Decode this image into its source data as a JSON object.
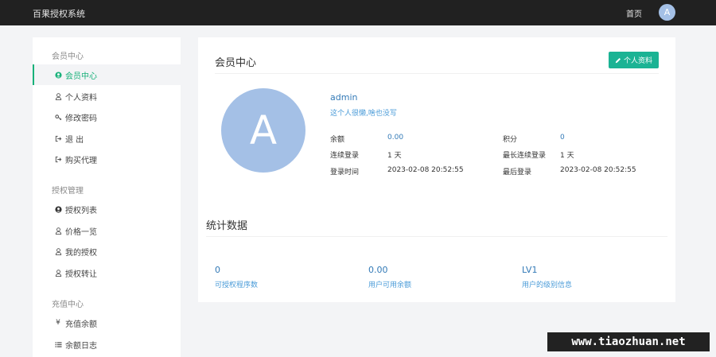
{
  "topbar": {
    "brand": "百果授权系统",
    "home": "首页",
    "avatar_letter": "A"
  },
  "sidebar": {
    "groups": [
      {
        "title": "会员中心"
      },
      {
        "title": "授权管理"
      },
      {
        "title": "充值中心"
      }
    ],
    "items": [
      {
        "label": "会员中心",
        "icon": "user-circle-icon",
        "active": true
      },
      {
        "label": "个人资料",
        "icon": "user-icon"
      },
      {
        "label": "修改密码",
        "icon": "key-icon"
      },
      {
        "label": "退 出",
        "icon": "sign-out-icon"
      },
      {
        "label": "购买代理",
        "icon": "sign-out-icon"
      },
      {
        "label": "授权列表",
        "icon": "user-circle-icon"
      },
      {
        "label": "价格一览",
        "icon": "user-icon"
      },
      {
        "label": "我的授权",
        "icon": "user-icon"
      },
      {
        "label": "授权转让",
        "icon": "user-icon"
      },
      {
        "label": "充值余额",
        "icon": "yen-icon"
      },
      {
        "label": "余额日志",
        "icon": "list-icon"
      }
    ]
  },
  "main": {
    "title": "会员中心",
    "edit_button": "个人资料",
    "avatar_letter": "A",
    "username": "admin",
    "signature": "这个人很懒,啥也没写",
    "info": {
      "balance_label": "余额",
      "balance": "0.00",
      "points_label": "积分",
      "points": "0",
      "consecutive_label": "连续登录",
      "consecutive": "1 天",
      "longest_label": "最长连续登录",
      "longest": "1 天",
      "login_time_label": "登录时间",
      "login_time": "2023-02-08 20:52:55",
      "last_login_label": "最后登录",
      "last_login": "2023-02-08 20:52:55"
    },
    "stats_title": "统计数据",
    "stats": [
      {
        "value": "0",
        "label": "可授权程序数"
      },
      {
        "value": "0.00",
        "label": "用户可用余额"
      },
      {
        "value": "LV1",
        "label": "用户的级别信息"
      }
    ]
  },
  "watermark": "www.tiaozhuan.net",
  "colors": {
    "accent": "#18b17a",
    "button": "#1bb394",
    "link": "#337ab7",
    "avatar": "#a4c0e6",
    "topbar": "#212121"
  }
}
